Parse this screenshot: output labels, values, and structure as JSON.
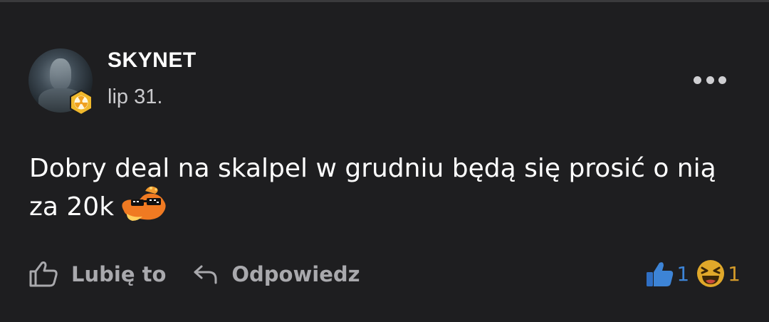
{
  "comment": {
    "author": "SKYNET",
    "timestamp": "lip 31.",
    "text_line1": "Dobry deal na skalpel w grudniu będą się prosić o nią",
    "text_line2": "za 20k",
    "sticker": "sunglasses-dragon-emoji",
    "badge": "radiation-hexagon-badge"
  },
  "actions": {
    "like_label": "Lubię to",
    "reply_label": "Odpowiedz"
  },
  "reactions": {
    "like_count": "1",
    "haha_count": "1"
  },
  "colors": {
    "background": "#1e1e20",
    "text": "#ffffff",
    "muted": "#a9a9ad",
    "like_blue": "#3d84d6",
    "haha_yellow": "#d39a2a"
  }
}
